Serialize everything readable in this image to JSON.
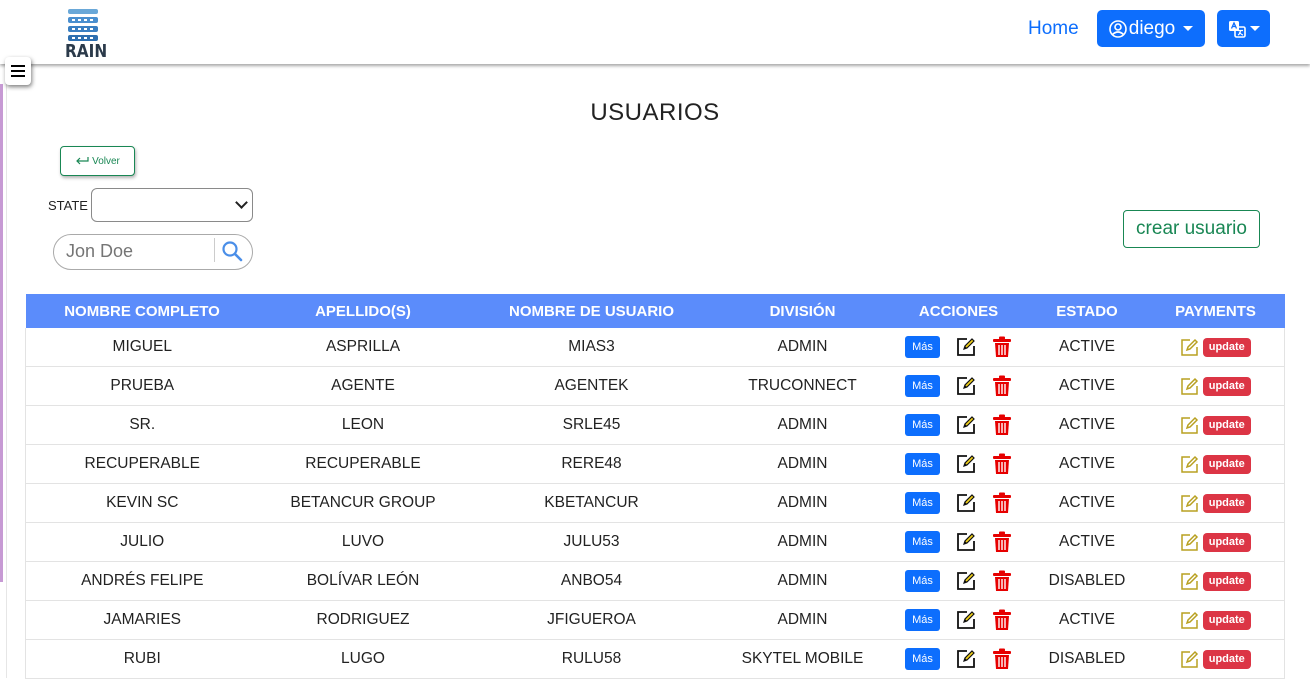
{
  "app": {
    "logo_text": "RAIN",
    "nav_home": "Home",
    "user_label": "diego",
    "brand_color": "#0d6efd"
  },
  "page": {
    "title": "USUARIOS",
    "back_label": "Volver",
    "state_label": "STATE",
    "state_value": "",
    "search_placeholder": "Jon Doe",
    "create_label": "crear usuario"
  },
  "table": {
    "columns": [
      "NOMBRE COMPLETO",
      "APELLIDO(S)",
      "NOMBRE DE USUARIO",
      "DIVISIÓN",
      "ACCIONES",
      "ESTADO",
      "PAYMENTS"
    ],
    "more_label": "Más",
    "update_label": "update",
    "rows": [
      {
        "name": "MIGUEL",
        "surname": "ASPRILLA",
        "username": "MIAS3",
        "division": "ADMIN",
        "status": "ACTIVE"
      },
      {
        "name": "PRUEBA",
        "surname": "AGENTE",
        "username": "AGENTEK",
        "division": "TRUCONNECT",
        "status": "ACTIVE"
      },
      {
        "name": "SR.",
        "surname": "LEON",
        "username": "SRLE45",
        "division": "ADMIN",
        "status": "ACTIVE"
      },
      {
        "name": "RECUPERABLE",
        "surname": "RECUPERABLE",
        "username": "RERE48",
        "division": "ADMIN",
        "status": "ACTIVE"
      },
      {
        "name": "KEVIN SC",
        "surname": "BETANCUR GROUP",
        "username": "KBETANCUR",
        "division": "ADMIN",
        "status": "ACTIVE"
      },
      {
        "name": "JULIO",
        "surname": "LUVO",
        "username": "JULU53",
        "division": "ADMIN",
        "status": "ACTIVE"
      },
      {
        "name": "ANDRÉS FELIPE",
        "surname": "BOLÍVAR LEÓN",
        "username": "ANBO54",
        "division": "ADMIN",
        "status": "DISABLED"
      },
      {
        "name": "JAMARIES",
        "surname": "RODRIGUEZ",
        "username": "JFIGUEROA",
        "division": "ADMIN",
        "status": "ACTIVE"
      },
      {
        "name": "RUBI",
        "surname": "LUGO",
        "username": "RULU58",
        "division": "SKYTEL MOBILE",
        "status": "DISABLED"
      }
    ]
  }
}
